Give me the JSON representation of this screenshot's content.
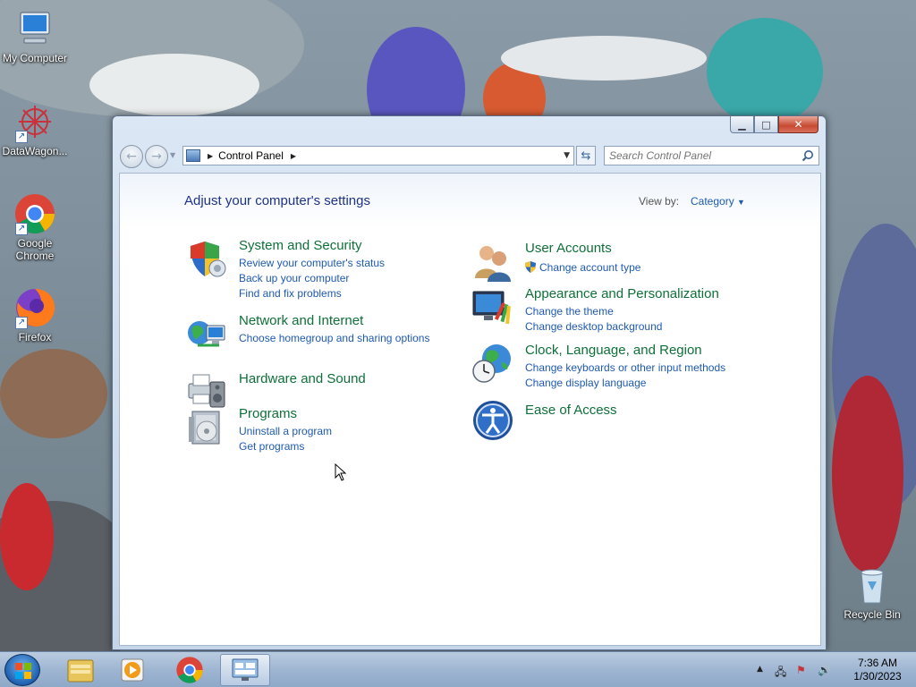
{
  "desktop": {
    "icons": [
      {
        "label": "My Computer"
      },
      {
        "label": "DataWagon..."
      },
      {
        "label": "Google Chrome"
      },
      {
        "label": "Firefox"
      },
      {
        "label": "Recycle Bin"
      }
    ]
  },
  "window": {
    "breadcrumb": [
      "Control Panel"
    ],
    "search_placeholder": "Search Control Panel",
    "heading": "Adjust your computer's settings",
    "view_by_label": "View by:",
    "view_by_value": "Category",
    "categories": [
      {
        "title": "System and Security",
        "icon": "shield-icon",
        "links": [
          "Review your computer's status",
          "Back up your computer",
          "Find and fix problems"
        ]
      },
      {
        "title": "Network and Internet",
        "icon": "network-icon",
        "links": [
          "Choose homegroup and sharing options"
        ]
      },
      {
        "title": "Hardware and Sound",
        "icon": "printer-icon",
        "links": []
      },
      {
        "title": "Programs",
        "icon": "programs-icon",
        "links": [
          "Uninstall a program",
          "Get programs"
        ]
      },
      {
        "title": "User Accounts",
        "icon": "users-icon",
        "links": [
          "Change account type"
        ]
      },
      {
        "title": "Appearance and Personalization",
        "icon": "monitor-icon",
        "links": [
          "Change the theme",
          "Change desktop background"
        ]
      },
      {
        "title": "Clock, Language, and Region",
        "icon": "globe-clock-icon",
        "links": [
          "Change keyboards or other input methods",
          "Change display language"
        ]
      },
      {
        "title": "Ease of Access",
        "icon": "ease-of-access-icon",
        "links": []
      }
    ]
  },
  "taskbar": {
    "time": "7:36 AM",
    "date": "1/30/2023"
  },
  "colors": {
    "category_title": "#0e7038",
    "link": "#1e5ab0",
    "heading": "#1e3287"
  }
}
